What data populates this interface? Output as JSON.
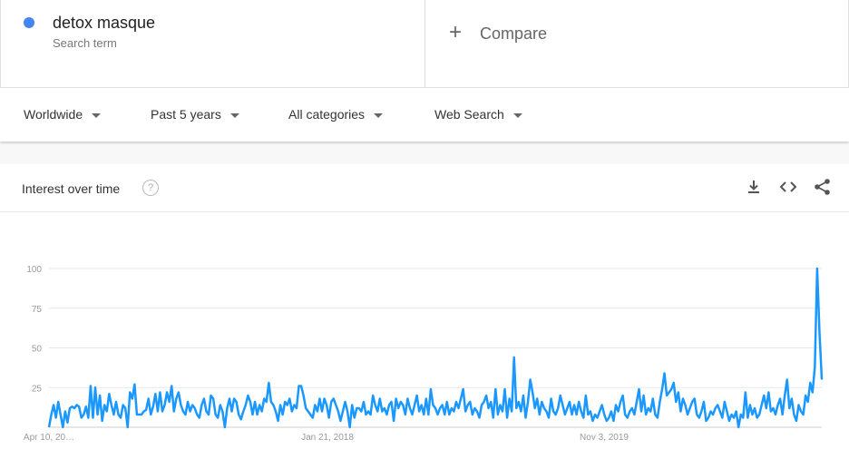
{
  "term": {
    "name": "detox masque",
    "subtitle": "Search term",
    "color": "#4285f4"
  },
  "compare": {
    "plus": "+",
    "label": "Compare"
  },
  "filters": [
    {
      "label": "Worldwide"
    },
    {
      "label": "Past 5 years"
    },
    {
      "label": "All categories"
    },
    {
      "label": "Web Search"
    }
  ],
  "card": {
    "title": "Interest over time",
    "help": "?",
    "icons": [
      "download-icon",
      "embed-code-icon",
      "share-icon"
    ]
  },
  "chart_data": {
    "type": "line",
    "title": "",
    "xlabel": "",
    "ylabel": "",
    "ylim": [
      0,
      100
    ],
    "yticks": [
      25,
      50,
      75,
      100
    ],
    "xtick_labels": [
      "Apr 10, 20…",
      "Jan 21, 2018",
      "Nov 3, 2019"
    ],
    "grid": true,
    "series_color": "#1a98ff",
    "series": [
      {
        "values": [
          0,
          8,
          14,
          6,
          16,
          8,
          0,
          10,
          3,
          12,
          13,
          12,
          14,
          13,
          6,
          8,
          13,
          6,
          26,
          6,
          25,
          8,
          20,
          4,
          14,
          10,
          21,
          14,
          8,
          16,
          8,
          6,
          14,
          12,
          0,
          22,
          18,
          27,
          8,
          8,
          8,
          10,
          11,
          18,
          8,
          13,
          21,
          10,
          22,
          10,
          14,
          22,
          16,
          26,
          10,
          18,
          22,
          14,
          10,
          8,
          16,
          10,
          14,
          12,
          8,
          6,
          14,
          18,
          10,
          8,
          20,
          18,
          8,
          6,
          14,
          10,
          0,
          12,
          18,
          10,
          18,
          16,
          8,
          5,
          10,
          14,
          20,
          16,
          8,
          16,
          8,
          14,
          10,
          18,
          16,
          28,
          16,
          14,
          10,
          4,
          14,
          8,
          16,
          14,
          18,
          10,
          14,
          12,
          26,
          26,
          20,
          12,
          10,
          8,
          6,
          14,
          10,
          18,
          10,
          18,
          14,
          6,
          16,
          18,
          14,
          10,
          4,
          10,
          16,
          10,
          0,
          14,
          6,
          12,
          12,
          10,
          16,
          8,
          10,
          8,
          20,
          14,
          10,
          18,
          10,
          12,
          8,
          14,
          16,
          4,
          18,
          12,
          16,
          14,
          8,
          18,
          12,
          8,
          14,
          20,
          10,
          14,
          8,
          18,
          8,
          24,
          14,
          12,
          8,
          12,
          14,
          8,
          16,
          8,
          12,
          10,
          16,
          12,
          18,
          24,
          10,
          14,
          16,
          8,
          12,
          10,
          6,
          14,
          16,
          20,
          12,
          16,
          6,
          24,
          8,
          14,
          10,
          24,
          6,
          18,
          10,
          44,
          12,
          16,
          10,
          20,
          6,
          16,
          30,
          22,
          12,
          18,
          8,
          16,
          12,
          10,
          6,
          18,
          10,
          8,
          12,
          20,
          14,
          8,
          12,
          16,
          8,
          14,
          8,
          16,
          10,
          6,
          20,
          8,
          10,
          4,
          8,
          6,
          10,
          14,
          8,
          4,
          6,
          10,
          4,
          14,
          10,
          16,
          20,
          8,
          6,
          10,
          12,
          8,
          16,
          24,
          10,
          20,
          8,
          12,
          10,
          18,
          8,
          6,
          16,
          24,
          34,
          20,
          22,
          24,
          28,
          16,
          22,
          10,
          18,
          14,
          8,
          12,
          16,
          18,
          8,
          6,
          10,
          16,
          4,
          6,
          10,
          8,
          12,
          14,
          10,
          6,
          16,
          10,
          4,
          8,
          6,
          10,
          0,
          8,
          6,
          22,
          6,
          14,
          8,
          12,
          6,
          8,
          14,
          20,
          12,
          22,
          10,
          12,
          8,
          14,
          18,
          8,
          20,
          30,
          12,
          18,
          8,
          4,
          14,
          10,
          8,
          20,
          16,
          28,
          22,
          38,
          100,
          60,
          30
        ]
      }
    ]
  }
}
